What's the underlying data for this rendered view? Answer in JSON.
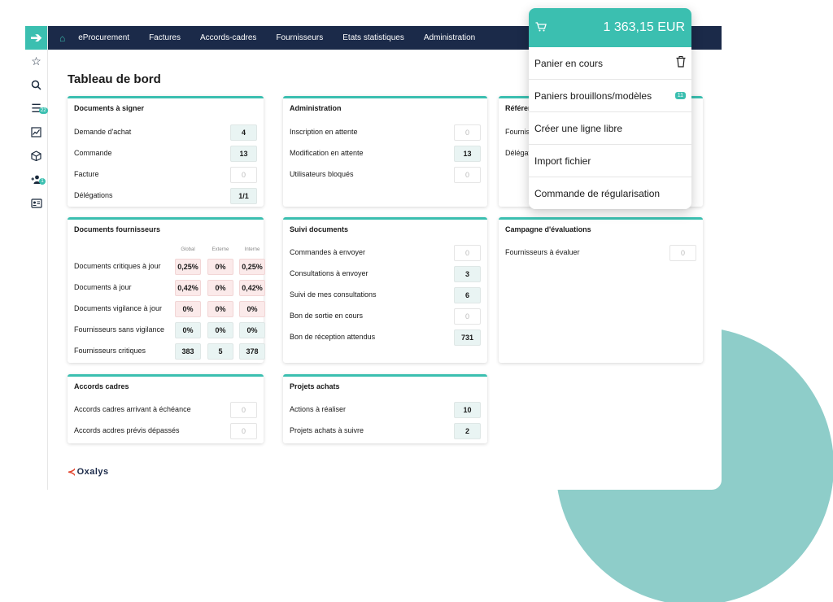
{
  "nav": {
    "items": [
      "eProcurement",
      "Factures",
      "Accords-cadres",
      "Fournisseurs",
      "Etats statistiques",
      "Administration"
    ]
  },
  "sidebar": {
    "badges": {
      "tasks": "22",
      "users": "1"
    }
  },
  "page_title": "Tableau de bord",
  "cards": {
    "documents_signer": {
      "title": "Documents à signer",
      "rows": [
        {
          "label": "Demande d'achat",
          "value": "4"
        },
        {
          "label": "Commande",
          "value": "13"
        },
        {
          "label": "Facture",
          "value": "0"
        },
        {
          "label": "Délégations",
          "value": "1/1"
        }
      ]
    },
    "administration": {
      "title": "Administration",
      "rows": [
        {
          "label": "Inscription en attente",
          "value": "0"
        },
        {
          "label": "Modification en attente",
          "value": "13"
        },
        {
          "label": "Utilisateurs bloqués",
          "value": "0"
        }
      ]
    },
    "referentiel": {
      "title": "Référen",
      "rows": [
        {
          "label": "Fournis"
        },
        {
          "label": "Délégat"
        }
      ]
    },
    "documents_fournisseurs": {
      "title": "Documents fournisseurs",
      "col_headers": [
        "Global",
        "Externe",
        "Interne"
      ],
      "rows": [
        {
          "label": "Documents critiques à jour",
          "values": [
            "0,25%",
            "0%",
            "0,25%"
          ]
        },
        {
          "label": "Documents à jour",
          "values": [
            "0,42%",
            "0%",
            "0,42%"
          ]
        },
        {
          "label": "Documents vigilance à jour",
          "values": [
            "0%",
            "0%",
            "0%"
          ]
        },
        {
          "label": "Fournisseurs sans vigilance",
          "values": [
            "0%",
            "0%",
            "0%"
          ]
        },
        {
          "label": "Fournisseurs critiques",
          "values": [
            "383",
            "5",
            "378"
          ]
        }
      ]
    },
    "suivi_documents": {
      "title": "Suivi documents",
      "rows": [
        {
          "label": "Commandes à envoyer",
          "value": "0"
        },
        {
          "label": "Consultations à envoyer",
          "value": "3"
        },
        {
          "label": "Suivi de mes consultations",
          "value": "6"
        },
        {
          "label": "Bon de sortie en cours",
          "value": "0"
        },
        {
          "label": "Bon de réception attendus",
          "value": "731"
        }
      ]
    },
    "campagne": {
      "title": "Campagne d'évaluations",
      "rows": [
        {
          "label": "Fournisseurs à évaluer",
          "value": "0"
        }
      ]
    },
    "accords_cadres": {
      "title": "Accords cadres",
      "rows": [
        {
          "label": "Accords cadres arrivant à échéance",
          "value": "0"
        },
        {
          "label": "Accords acdres prévis dépassés",
          "value": "0"
        }
      ]
    },
    "projets_achats": {
      "title": "Projets achats",
      "rows": [
        {
          "label": "Actions à réaliser",
          "value": "10"
        },
        {
          "label": "Projets achats à suivre",
          "value": "2"
        }
      ]
    }
  },
  "logo": {
    "text": "Oxalys"
  },
  "cart": {
    "total": "1 363,15 EUR",
    "items": [
      {
        "label": "Panier en cours"
      },
      {
        "label": "Paniers brouillons/modèles",
        "badge": "11"
      },
      {
        "label": "Créer une ligne libre"
      },
      {
        "label": "Import fichier"
      },
      {
        "label": "Commande de régularisation"
      }
    ]
  },
  "colors": {
    "accent": "#3bbfb0",
    "navbar": "#1b2a49",
    "decor": "#8ecdc9"
  },
  "icons": [
    "arrow-right-icon",
    "star-icon",
    "search-icon",
    "list-icon",
    "chart-icon",
    "box-icon",
    "user-add-icon",
    "id-card-icon",
    "home-icon",
    "cart-icon",
    "trash-icon"
  ]
}
